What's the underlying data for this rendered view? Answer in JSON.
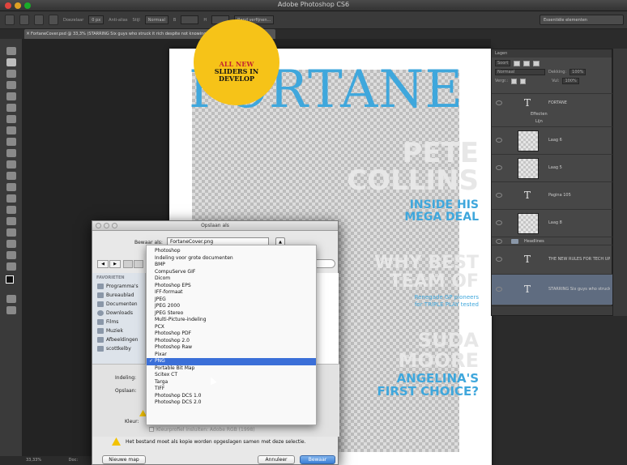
{
  "app": {
    "title": "Adobe Photoshop CS6"
  },
  "options_bar": {
    "fields": [
      "Doezelaar",
      "0 px",
      "Anti-alias",
      "Stijl",
      "Normaal",
      "B",
      "H",
      "Rand verfijnen..."
    ],
    "workspace": "Essentiële elementen"
  },
  "document": {
    "tab_title": "FortaneCover.psd @ 33,3% (STARRING Six guys who struck it rich despite not knowing Matt K, RGB/8) *",
    "zoom": "33,33%",
    "status_doc": "Doc:"
  },
  "cover": {
    "badge_line1": "ALL NEW",
    "badge_line2": "SLIDERS IN",
    "badge_line3": "DEVELOP",
    "masthead": "FORTANE",
    "headline1": "PETE",
    "headline2": "COLLINS",
    "sub1a": "INSIDE HIS",
    "sub1b": "MEGA DEAL",
    "headline3": "WHY BEST",
    "headline4": "TEAM OF",
    "small1": "Renegade GP pioneers",
    "small2": "for TRIPLE PLAY tested",
    "headline5": "SUDA",
    "headline6": "MOORE",
    "sub2a": "ANGELINA'S",
    "sub2b": "FIRST CHOICE?"
  },
  "layers_panel": {
    "tab": "Lagen",
    "filter": "Soort",
    "blend_mode": "Normaal",
    "opacity_label": "Dekking:",
    "opacity": "100%",
    "lock_label": "Vergr.:",
    "fill_label": "Vul:",
    "fill": "100%",
    "layers": [
      {
        "name": "FORTANE",
        "type": "text"
      },
      {
        "name": "Effecten",
        "type": "effect"
      },
      {
        "name": "Lijn",
        "type": "effect"
      },
      {
        "name": "Laag 6",
        "type": "pixel"
      },
      {
        "name": "Laag 5",
        "type": "pixel"
      },
      {
        "name": "Pagina 105",
        "type": "text"
      },
      {
        "name": "Laag 8",
        "type": "pixel"
      },
      {
        "name": "Headlines",
        "type": "group"
      },
      {
        "name": "THE NEW RULES FOR TECH UPSTA...",
        "type": "text"
      },
      {
        "name": "STARRING Six guys who struck it r...",
        "type": "text"
      }
    ]
  },
  "save_dialog": {
    "title": "Opslaan als",
    "save_as_label": "Bewaar als:",
    "filename": "FortaneCover.png",
    "favorites_header": "FAVORIETEN",
    "favorites": [
      "Programma's",
      "Bureaublad",
      "Documenten",
      "Downloads",
      "Films",
      "Muziek",
      "Afbeeldingen",
      "scottkelby"
    ],
    "format_label": "Indeling:",
    "save_label": "Opslaan:",
    "color_label": "Kleur:",
    "icc_label": "Kleurprofiel insluiten: Adobe RGB (1998)",
    "warning": "Het bestand moet als kopie worden opgeslagen samen met deze selectie.",
    "new_folder": "Nieuwe map",
    "cancel": "Annuleer",
    "save": "Bewaar",
    "format_options": [
      "Photoshop",
      "Indeling voor grote documenten",
      "BMP",
      "CompuServe GIF",
      "Dicom",
      "Photoshop EPS",
      "IFF-formaat",
      "JPEG",
      "JPEG 2000",
      "JPEG Stereo",
      "Multi-Picture-indeling",
      "PCX",
      "Photoshop PDF",
      "Photoshop 2.0",
      "Photoshop Raw",
      "Pixar",
      "PNG",
      "Portable Bit Map",
      "Scitex CT",
      "Targa",
      "TIFF",
      "Photoshop DCS 1.0",
      "Photoshop DCS 2.0"
    ],
    "selected_format": "PNG"
  },
  "colors": {
    "accent": "#3fa7dc",
    "badge": "#f6c318",
    "selection": "#3b6fd8"
  }
}
